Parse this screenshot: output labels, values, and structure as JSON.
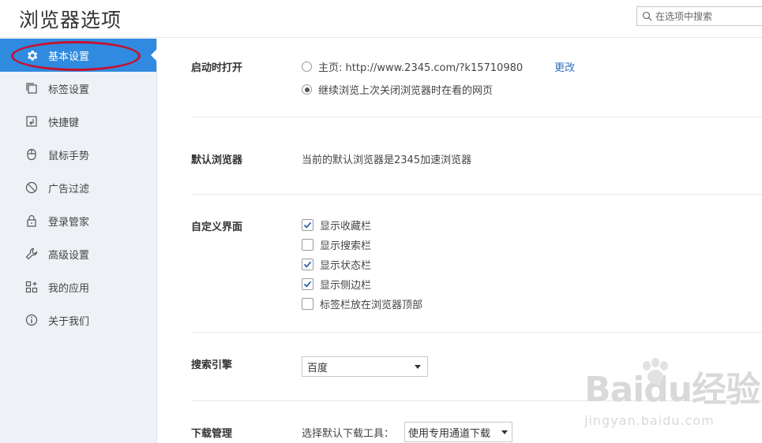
{
  "header": {
    "title": "浏览器选项",
    "search_placeholder": "在选项中搜索"
  },
  "sidebar": {
    "items": [
      {
        "label": "基本设置",
        "icon": "gear-icon",
        "active": true
      },
      {
        "label": "标签设置",
        "icon": "tabs-icon",
        "active": false
      },
      {
        "label": "快捷键",
        "icon": "shortcut-icon",
        "active": false
      },
      {
        "label": "鼠标手势",
        "icon": "mouse-icon",
        "active": false
      },
      {
        "label": "广告过滤",
        "icon": "block-icon",
        "active": false
      },
      {
        "label": "登录管家",
        "icon": "lock-icon",
        "active": false
      },
      {
        "label": "高级设置",
        "icon": "wrench-icon",
        "active": false
      },
      {
        "label": "我的应用",
        "icon": "apps-icon",
        "active": false
      },
      {
        "label": "关于我们",
        "icon": "info-icon",
        "active": false
      }
    ]
  },
  "startup": {
    "label": "启动时打开",
    "homepage_label": "主页: http://www.2345.com/?k15710980",
    "change_link": "更改",
    "continue_label": "继续浏览上次关闭浏览器时在看的网页",
    "selected": "continue"
  },
  "default_browser": {
    "label": "默认浏览器",
    "text": "当前的默认浏览器是2345加速浏览器"
  },
  "custom_ui": {
    "label": "自定义界面",
    "options": [
      {
        "label": "显示收藏栏",
        "checked": true
      },
      {
        "label": "显示搜索栏",
        "checked": false
      },
      {
        "label": "显示状态栏",
        "checked": true
      },
      {
        "label": "显示侧边栏",
        "checked": true
      },
      {
        "label": "标签栏放在浏览器顶部",
        "checked": false
      }
    ]
  },
  "search_engine": {
    "label": "搜索引擎",
    "selected": "百度"
  },
  "download": {
    "label": "下载管理",
    "prompt": "选择默认下载工具：",
    "selected": "使用专用通道下载"
  },
  "watermark": {
    "main": "Baidu经验",
    "sub": "jingyan.baidu.com"
  },
  "colors": {
    "accent": "#2f8ae0",
    "annotation": "#c8102e",
    "link": "#2f6fc1"
  }
}
